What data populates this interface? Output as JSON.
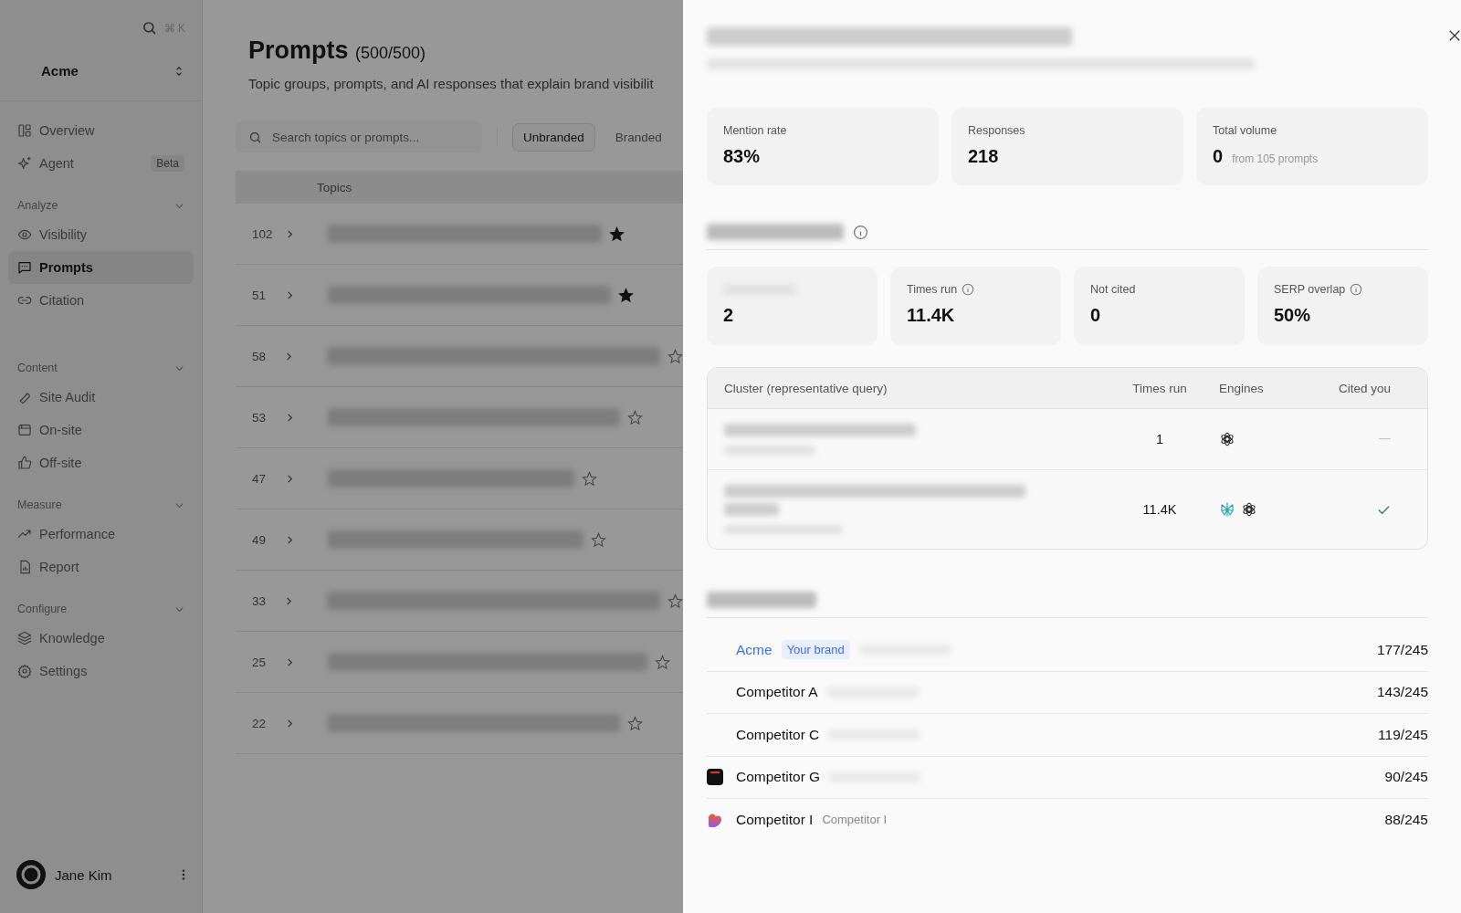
{
  "sidebar": {
    "search_shortcut": "⌘ K",
    "workspace": "Acme",
    "top_items": [
      {
        "label": "Overview",
        "selected": false
      },
      {
        "label": "Agent",
        "selected": false,
        "badge": "Beta"
      }
    ],
    "sections": [
      {
        "title": "Analyze",
        "items": [
          {
            "label": "Visibility",
            "selected": false
          },
          {
            "label": "Prompts",
            "selected": true
          },
          {
            "label": "Citation",
            "selected": false
          }
        ]
      },
      {
        "title": "Content",
        "items": [
          {
            "label": "Site Audit",
            "selected": false
          },
          {
            "label": "On-site",
            "selected": false
          },
          {
            "label": "Off-site",
            "selected": false
          }
        ]
      },
      {
        "title": "Measure",
        "items": [
          {
            "label": "Performance",
            "selected": false
          },
          {
            "label": "Report",
            "selected": false
          }
        ]
      },
      {
        "title": "Configure",
        "items": [
          {
            "label": "Knowledge",
            "selected": false
          },
          {
            "label": "Settings",
            "selected": false
          }
        ]
      }
    ],
    "user": "Jane Kim"
  },
  "main": {
    "title": "Prompts",
    "count": "(500/500)",
    "subtitle": "Topic groups, prompts, and AI responses that explain brand visibilit",
    "search": {
      "placeholder": "Search topics or prompts..."
    },
    "filters": [
      {
        "label": "Unbranded",
        "selected": true
      },
      {
        "label": "Branded",
        "selected": false
      }
    ],
    "column": "Topics",
    "rows": [
      {
        "count": "102",
        "starred": true
      },
      {
        "count": "51",
        "starred": true
      },
      {
        "count": "58",
        "starred": false
      },
      {
        "count": "53",
        "starred": false
      },
      {
        "count": "47",
        "starred": false
      },
      {
        "count": "49",
        "starred": false
      },
      {
        "count": "33",
        "starred": false
      },
      {
        "count": "25",
        "starred": false
      },
      {
        "count": "22",
        "starred": false
      }
    ]
  },
  "drawer": {
    "stats": [
      {
        "label": "Mention rate",
        "value": "83%"
      },
      {
        "label": "Responses",
        "value": "218"
      },
      {
        "label": "Total volume",
        "value": "0",
        "note": "from 105 prompts"
      }
    ],
    "metrics": [
      {
        "value": "2",
        "info": false
      },
      {
        "label": "Times run",
        "value": "11.4K",
        "info": true
      },
      {
        "label": "Not cited",
        "value": "0",
        "info": false
      },
      {
        "label": "SERP overlap",
        "value": "50%",
        "info": true
      }
    ],
    "table": {
      "columns": [
        "Cluster (representative query)",
        "Times run",
        "Engines",
        "Cited you"
      ],
      "rows": [
        {
          "times_run": "1",
          "engines": [
            {
              "kind": "knot"
            }
          ],
          "cited": false
        },
        {
          "times_run": "11.4K",
          "engines": [
            {
              "kind": "snowflake"
            },
            {
              "kind": "knot"
            }
          ],
          "cited": true
        }
      ]
    },
    "brands": [
      {
        "kind": "plain",
        "name": "Acme",
        "is_brand": true,
        "tag": "Your brand",
        "score": "177/245"
      },
      {
        "kind": "plain",
        "name": "Competitor A",
        "is_brand": false,
        "score": "143/245"
      },
      {
        "kind": "plain",
        "name": "Competitor C",
        "is_brand": false,
        "score": "119/245"
      },
      {
        "kind": "square",
        "name": "Competitor G",
        "is_brand": false,
        "score": "90/245"
      },
      {
        "kind": "heart",
        "name": "Competitor I",
        "is_brand": false,
        "domain": "Competitor I",
        "score": "88/245"
      }
    ]
  }
}
